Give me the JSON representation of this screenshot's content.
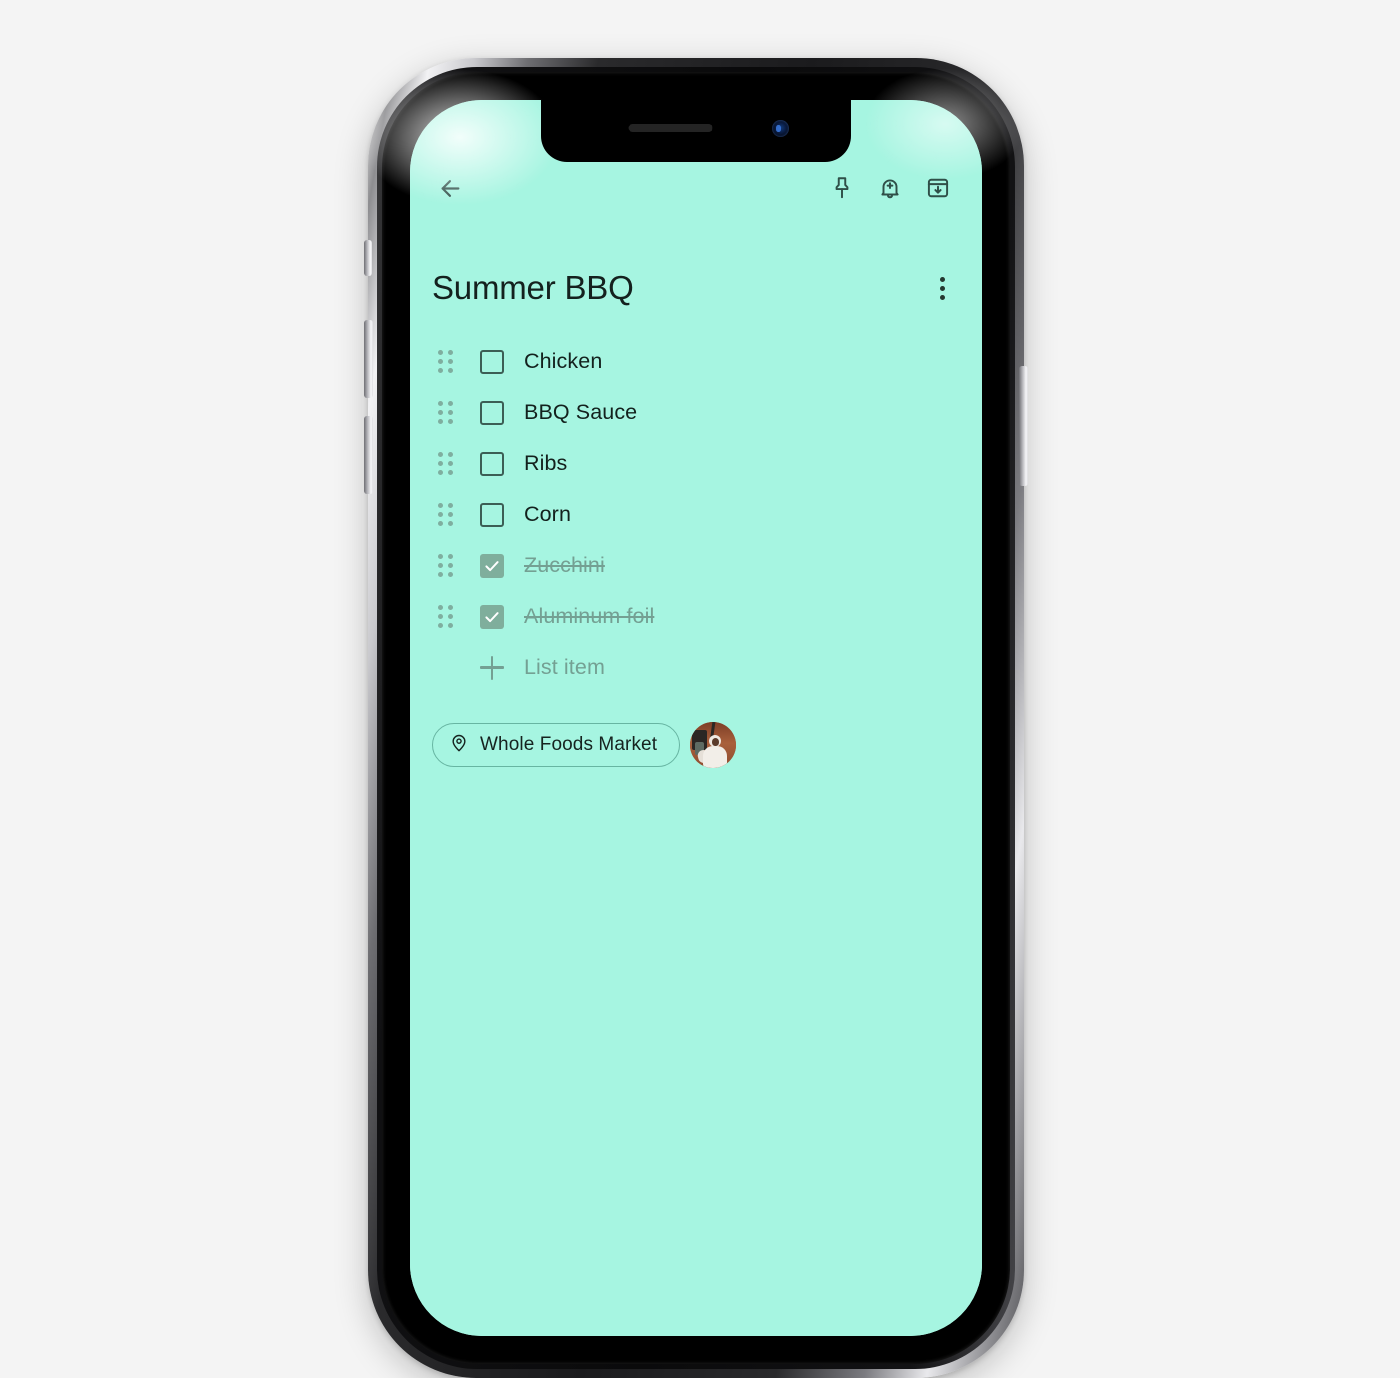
{
  "theme": {
    "page_background": "#f4f4f4",
    "note_background": "#a6f5e1",
    "text_primary": "#13211d",
    "text_muted": "#74a093",
    "checkbox_checked_fill": "#7fae9c",
    "chip_border": "#67b5a2"
  },
  "device": {
    "name": "smartphone-mockup",
    "notch": {
      "speaker": "earpiece-speaker",
      "camera": "front-camera"
    },
    "buttons": [
      "mute-switch",
      "volume-up",
      "volume-down",
      "power"
    ]
  },
  "appbar": {
    "back": {
      "icon": "arrow-back-icon",
      "label": "Back"
    },
    "actions": [
      {
        "icon": "pin-icon",
        "label": "Pin note"
      },
      {
        "icon": "bell-plus-icon",
        "label": "Remind me"
      },
      {
        "icon": "archive-icon",
        "label": "Archive"
      }
    ]
  },
  "note": {
    "title": "Summer BBQ",
    "overflow_menu": {
      "icon": "more-vert-icon",
      "label": "More options"
    },
    "items": [
      {
        "text": "Chicken",
        "checked": false
      },
      {
        "text": "BBQ Sauce",
        "checked": false
      },
      {
        "text": "Ribs",
        "checked": false
      },
      {
        "text": "Corn",
        "checked": false
      },
      {
        "text": "Zucchini",
        "checked": true
      },
      {
        "text": "Aluminum foil",
        "checked": true
      }
    ],
    "add_item": {
      "icon": "plus-icon",
      "label": "List item"
    },
    "label_chip": {
      "icon": "location-pin-icon",
      "label": "Whole Foods Market"
    },
    "collaborator": {
      "name": "collaborator-avatar",
      "alt": "Collaborator profile photo"
    }
  }
}
